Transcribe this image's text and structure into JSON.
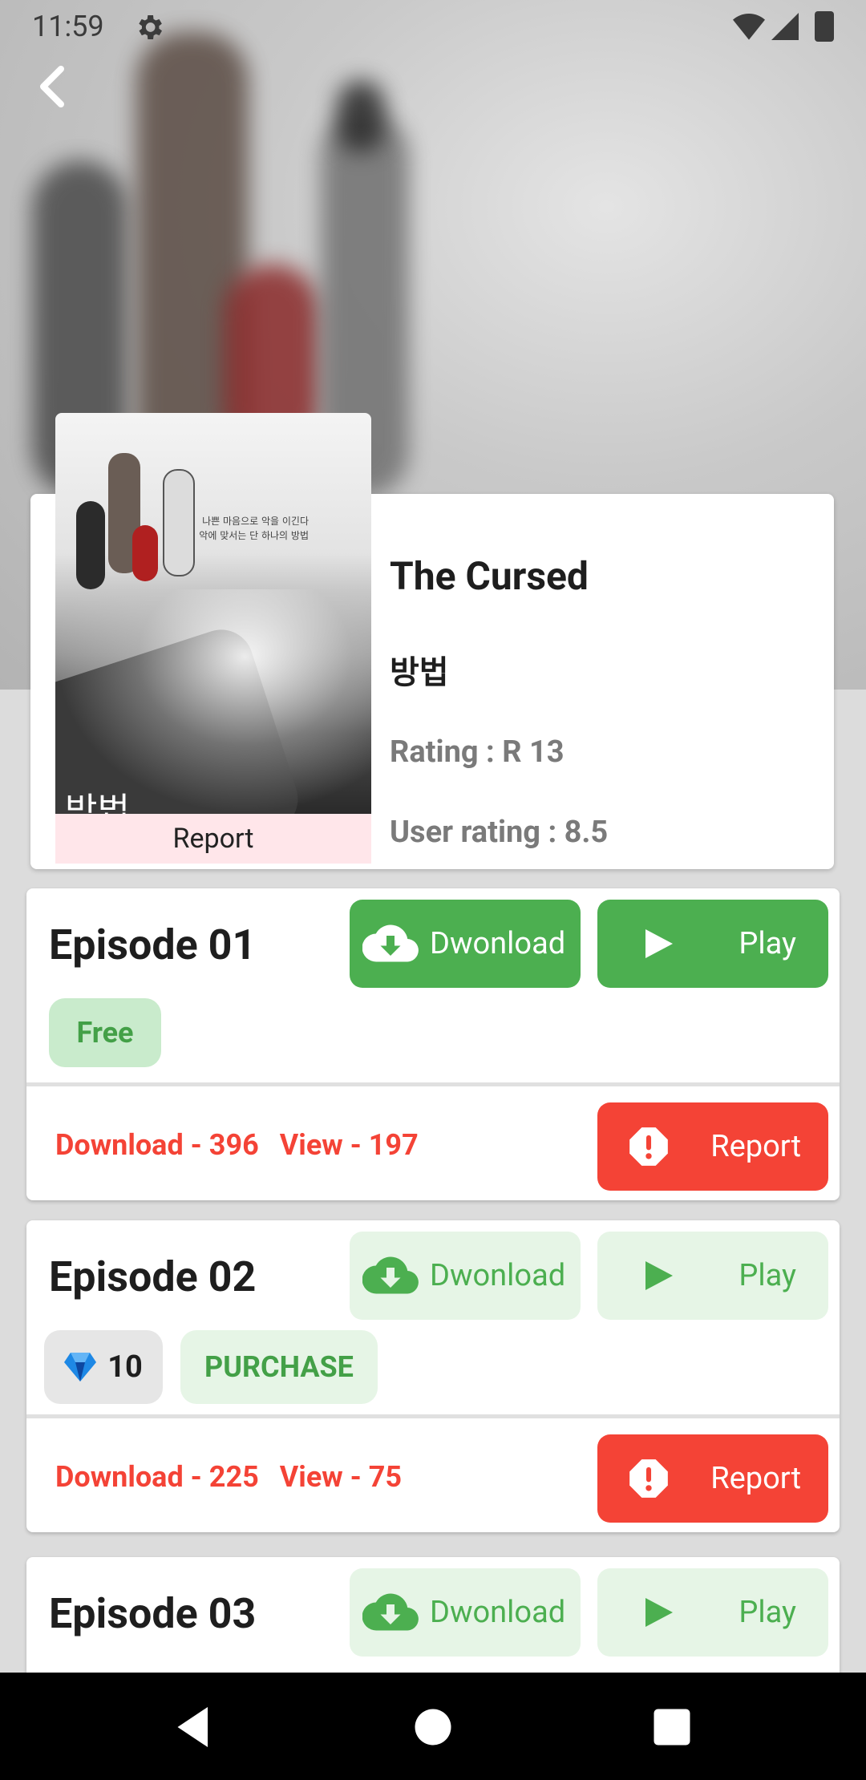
{
  "status_bar": {
    "time": "11:59"
  },
  "show": {
    "title": "The Cursed",
    "title_native": "방법",
    "rating": "Rating : R 13",
    "user_rating": "User rating : 8.5",
    "poster_report_label": "Report",
    "poster_tagline": [
      "나쁜 마음으로 악을 이긴다",
      "악에 맞서는 단 하나의 방법"
    ],
    "poster_title": "방법"
  },
  "episodes": [
    {
      "title": "Episode 01",
      "download_label": "Dwonload",
      "play_label": "Play",
      "state": "active",
      "price_tag": "Free",
      "downloads": "Download - 396",
      "views": "View - 197",
      "report_label": "Report"
    },
    {
      "title": "Episode 02",
      "download_label": "Dwonload",
      "play_label": "Play",
      "state": "locked",
      "gem_cost": "10",
      "purchase_label": "PURCHASE",
      "downloads": "Download - 225",
      "views": "View - 75",
      "report_label": "Report"
    },
    {
      "title": "Episode 03",
      "download_label": "Dwonload",
      "play_label": "Play",
      "state": "locked"
    }
  ],
  "colors": {
    "accent_green": "#4caf50",
    "light_green": "#e6f5e6",
    "report_red": "#f44336",
    "gem_blue": "#2196f3"
  },
  "icons": [
    "gear-icon",
    "wifi-icon",
    "cell-signal-icon",
    "battery-icon",
    "back-arrow-icon",
    "cloud-download-icon",
    "play-icon",
    "alert-icon",
    "gem-icon",
    "nav-back-icon",
    "nav-home-icon",
    "nav-recents-icon"
  ]
}
